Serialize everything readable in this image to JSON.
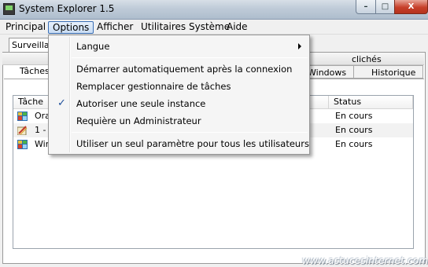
{
  "window": {
    "title": "System Explorer 1.5",
    "buttons": {
      "minimize": "–",
      "maximize": "□",
      "close": "X"
    }
  },
  "menubar": {
    "items": [
      "Principal",
      "Options",
      "Afficher",
      "Utilitaires Système",
      "Aide"
    ],
    "active": "Options"
  },
  "options_menu": {
    "items": [
      {
        "label": "Langue",
        "has_submenu": true
      },
      {
        "label": "Démarrer automatiquement après la connexion",
        "checked": false
      },
      {
        "label": "Remplacer gestionnaire de tâches",
        "checked": false
      },
      {
        "label": "Autoriser une seule instance",
        "checked": true
      },
      {
        "label": "Requière un Administrateur",
        "checked": false
      },
      {
        "label": "Utiliser un seul paramètre pour tous les utilisateurs",
        "checked": false
      }
    ],
    "check_glyph": "✓"
  },
  "tabs": {
    "top_tab": "Surveillan",
    "cliches": "clichés",
    "taches": "Tâches",
    "windows": "Windows",
    "historique": "Historique"
  },
  "list": {
    "columns": {
      "task": "Tâche",
      "status": "Status"
    },
    "rows": [
      {
        "name": "Ora",
        "status": "En cours",
        "icon": "app-icon"
      },
      {
        "name": "1 -",
        "status": "En cours",
        "icon": "pencil-app-icon"
      },
      {
        "name": "Win",
        "status": "En cours",
        "icon": "app-icon"
      }
    ]
  },
  "watermark": "www.astucesinternet.com"
}
